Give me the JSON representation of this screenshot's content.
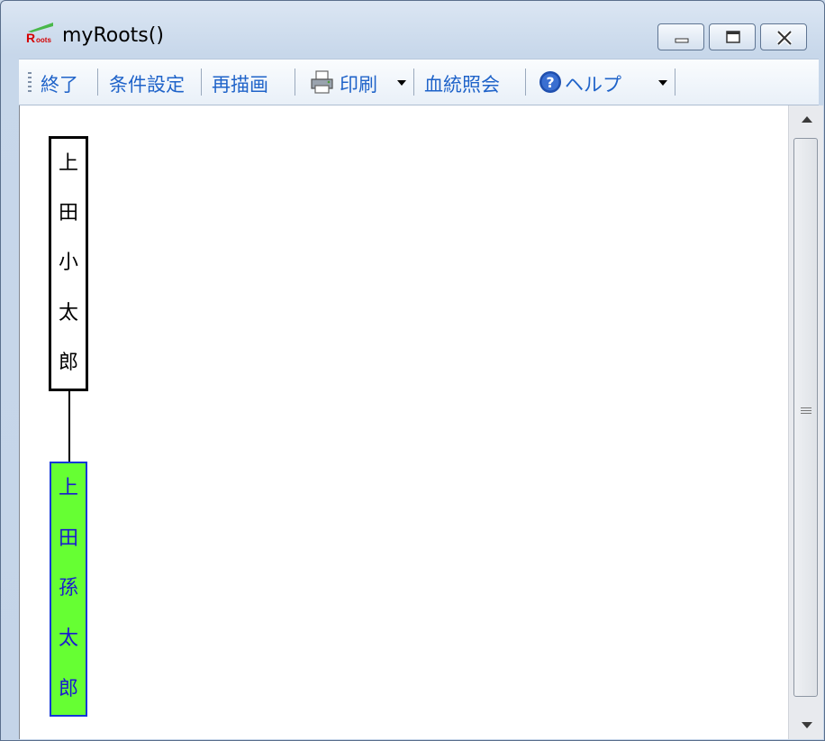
{
  "window": {
    "title": "myRoots()",
    "controls": {
      "minimize": "minimize",
      "maximize": "maximize",
      "close": "close"
    }
  },
  "toolbar": {
    "items": [
      {
        "label": "終了"
      },
      {
        "label": "条件設定"
      },
      {
        "label": "再描画"
      },
      {
        "label": "印刷",
        "icon": "printer-icon",
        "dropdown": true
      },
      {
        "label": "血統照会"
      },
      {
        "label": "ヘルプ",
        "icon": "help-icon",
        "dropdown": true
      }
    ]
  },
  "tree": {
    "parent": {
      "name_chars": [
        "上",
        "田",
        "小",
        "太",
        "郎"
      ],
      "border_color": "#000000",
      "fill_color": "#ffffff"
    },
    "child": {
      "name_chars": [
        "上",
        "田",
        "孫",
        "太",
        "郎"
      ],
      "border_color": "#1236d8",
      "fill_color": "#66ff33",
      "text_color": "#1a1ad0"
    }
  },
  "colors": {
    "accent_text": "#1f63c9"
  }
}
